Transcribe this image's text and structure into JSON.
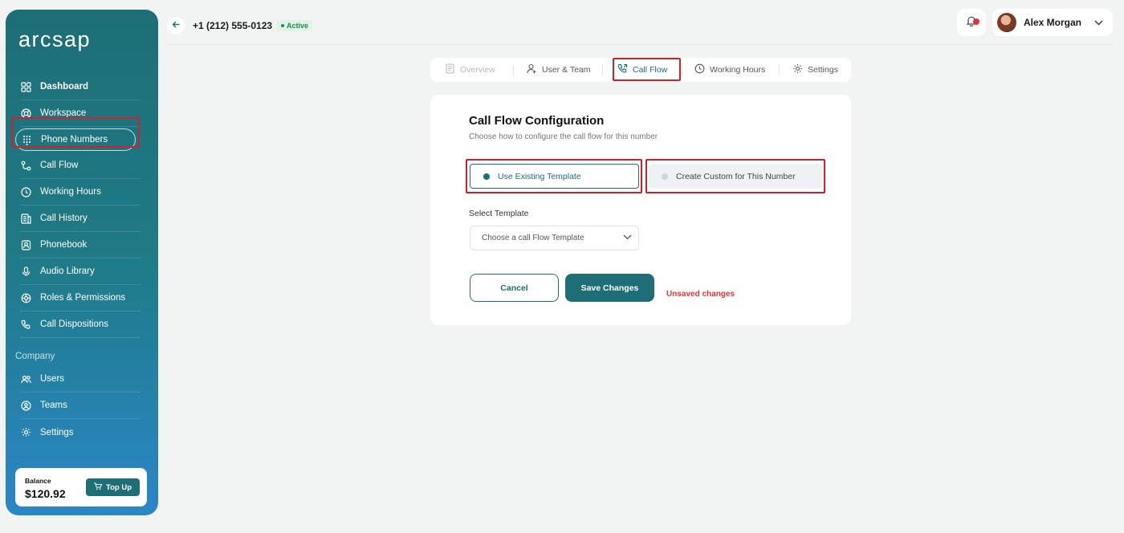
{
  "sidebar": {
    "logo": "arcsap",
    "items": [
      {
        "label": "Dashboard",
        "icon": "dashboard-icon"
      },
      {
        "label": "Workspace",
        "icon": "workspace-icon"
      },
      {
        "label": "Phone Numbers",
        "icon": "keypad-icon"
      },
      {
        "label": "Call Flow",
        "icon": "call-flow-icon"
      },
      {
        "label": "Working Hours",
        "icon": "clock-icon"
      },
      {
        "label": "Call History",
        "icon": "history-icon"
      },
      {
        "label": "Phonebook",
        "icon": "phonebook-icon"
      },
      {
        "label": "Audio Library",
        "icon": "mic-icon"
      },
      {
        "label": "Roles & Permissions",
        "icon": "shield-icon"
      },
      {
        "label": "Call Dispositions",
        "icon": "phone-icon"
      }
    ],
    "section_label": "Company",
    "company_items": [
      {
        "label": "Users",
        "icon": "users-icon"
      },
      {
        "label": "Teams",
        "icon": "teams-icon"
      },
      {
        "label": "Settings",
        "icon": "gear-icon"
      }
    ],
    "balance": {
      "label": "Balance",
      "value": "$120.92",
      "topup_label": "Top Up"
    }
  },
  "header": {
    "phone_number": "+1 (212) 555-0123",
    "status": "Active",
    "user_name": "Alex Morgan"
  },
  "tabs": [
    {
      "label": "Overview",
      "icon": "document-icon"
    },
    {
      "label": "User & Team",
      "icon": "user-icon"
    },
    {
      "label": "Call Flow",
      "icon": "call-flow-icon"
    },
    {
      "label": "Working Hours",
      "icon": "clock-icon"
    },
    {
      "label": "Settings",
      "icon": "gear-icon"
    }
  ],
  "card": {
    "title": "Call Flow Configuration",
    "subtitle": "Choose how to configure the call flow for this number",
    "option_existing": "Use Existing Template",
    "option_custom": "Create Custom for This Number",
    "select_label": "Select Template",
    "select_placeholder": "Choose a call Flow Template",
    "cancel_label": "Cancel",
    "save_label": "Save Changes",
    "unsaved_text": "Unsaved changes"
  },
  "colors": {
    "accent": "#1d6e76",
    "highlight": "#d0202a",
    "warning": "#d9383a"
  }
}
